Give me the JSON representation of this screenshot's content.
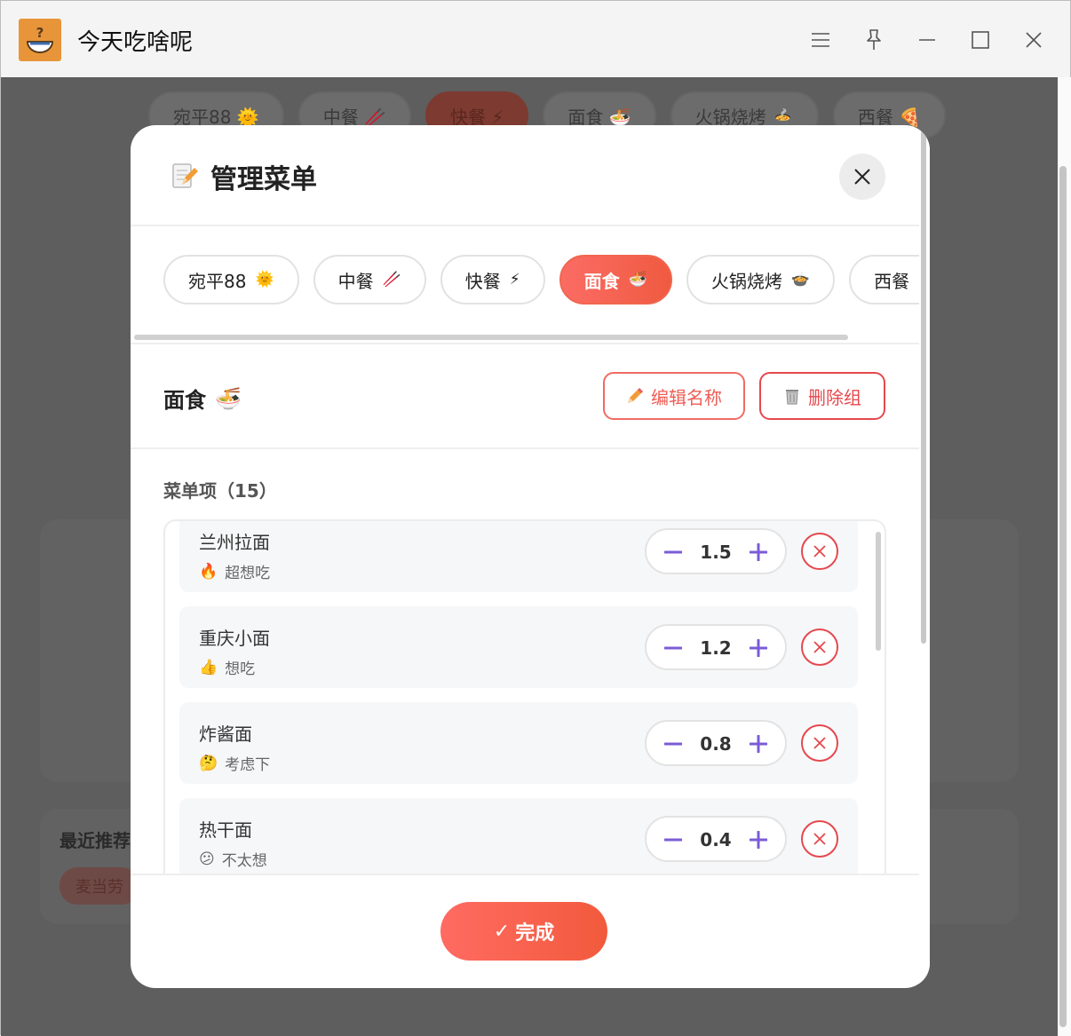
{
  "window": {
    "title": "今天吃啥呢"
  },
  "background": {
    "tabs": [
      "宛平88 🌞",
      "中餐 🥢",
      "快餐 ⚡",
      "面食 🍜",
      "火锅烧烤 🍲",
      "西餐 🍕"
    ],
    "recent_title": "最近推荐",
    "recent_chip": "麦当劳"
  },
  "modal": {
    "title": "管理菜单",
    "tabs": [
      {
        "label": "宛平88",
        "emoji": "🌞"
      },
      {
        "label": "中餐",
        "emoji": "🥢"
      },
      {
        "label": "快餐",
        "emoji": "⚡"
      },
      {
        "label": "面食",
        "emoji": "🍜",
        "active": true
      },
      {
        "label": "火锅烧烤",
        "emoji": "🍲"
      },
      {
        "label": "西餐",
        "emoji": "🍕"
      }
    ],
    "group": {
      "name": "面食",
      "emoji": "🍜"
    },
    "edit_name_label": "编辑名称",
    "delete_group_label": "删除组",
    "items_label": "菜单项（15）",
    "items": [
      {
        "name": "兰州拉面",
        "pref_icon": "🔥",
        "pref": "超想吃",
        "weight": "1.5"
      },
      {
        "name": "重庆小面",
        "pref_icon": "👍",
        "pref": "想吃",
        "weight": "1.2"
      },
      {
        "name": "炸酱面",
        "pref_icon": "🤔",
        "pref": "考虑下",
        "weight": "0.8"
      },
      {
        "name": "热干面",
        "pref_icon": "😕",
        "pref": "不太想",
        "weight": "0.4"
      }
    ],
    "done_label": "完成",
    "done_icon": "✓"
  },
  "colors": {
    "accent": "#F25A3C",
    "danger": "#E5484D",
    "stepper": "#7B5CD6"
  }
}
